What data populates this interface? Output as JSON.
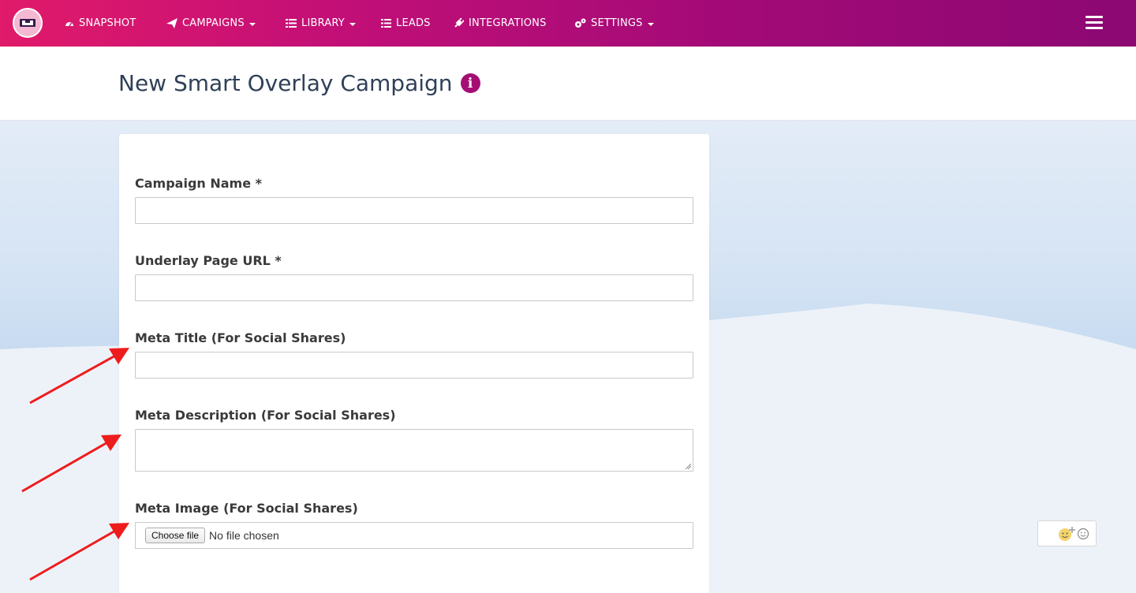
{
  "nav": {
    "items": [
      {
        "label": "SNAPSHOT",
        "icon": "dashboard-icon"
      },
      {
        "label": "CAMPAIGNS",
        "icon": "paper-plane-icon",
        "dropdown": true
      },
      {
        "label": "LIBRARY",
        "icon": "library-icon",
        "dropdown": true
      },
      {
        "label": "LEADS",
        "icon": "list-icon"
      },
      {
        "label": "INTEGRATIONS",
        "icon": "plug-icon"
      },
      {
        "label": "SETTINGS",
        "icon": "gears-icon",
        "dropdown": true
      }
    ],
    "menu_icon": "hamburger-icon"
  },
  "page": {
    "title": "New Smart Overlay Campaign",
    "info_icon": "i"
  },
  "form": {
    "campaign_name_label": "Campaign Name *",
    "campaign_name_value": "",
    "underlay_url_label": "Underlay Page URL *",
    "underlay_url_value": "",
    "meta_title_label": "Meta Title (For Social Shares)",
    "meta_title_value": "",
    "meta_description_label": "Meta Description (For Social Shares)",
    "meta_description_value": "",
    "meta_image_label": "Meta Image (For Social Shares)",
    "choose_file_label": "Choose file",
    "no_file_text": "No file chosen"
  },
  "colors": {
    "nav_gradient_start": "#e11a6a",
    "nav_gradient_end": "#8c0873",
    "accent": "#a50f74",
    "title": "#2f4058",
    "annotation_arrow": "#ee1c1c"
  }
}
